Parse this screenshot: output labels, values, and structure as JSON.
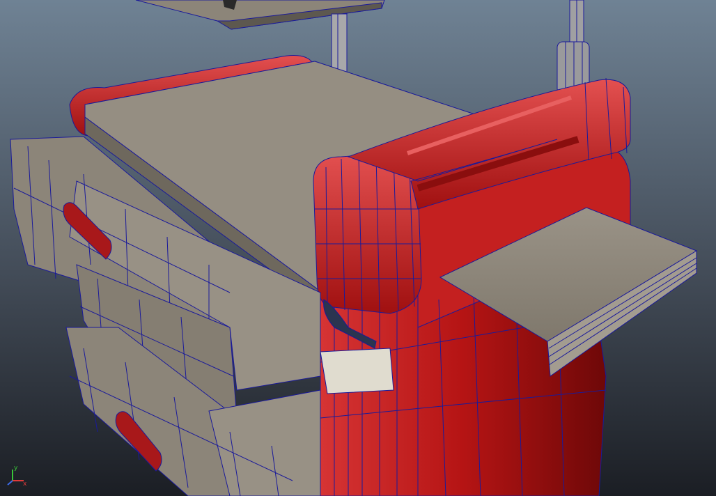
{
  "viewport": {
    "camera_label": "",
    "background_top": "#6f8294",
    "background_bottom": "#1b1e24"
  },
  "axis_gizmo": {
    "y_label": "y",
    "x_label": "x",
    "y_color": "#39c639",
    "x_color": "#e03a3a",
    "z_color": "#3d6be8"
  },
  "model": {
    "body_color": "#b51414",
    "body_highlight": "#e35050",
    "drawer_color": "#8c8579",
    "top_color": "#8f887c",
    "wire_color": "#1a1a9a",
    "handle_color": "#a8181a"
  }
}
